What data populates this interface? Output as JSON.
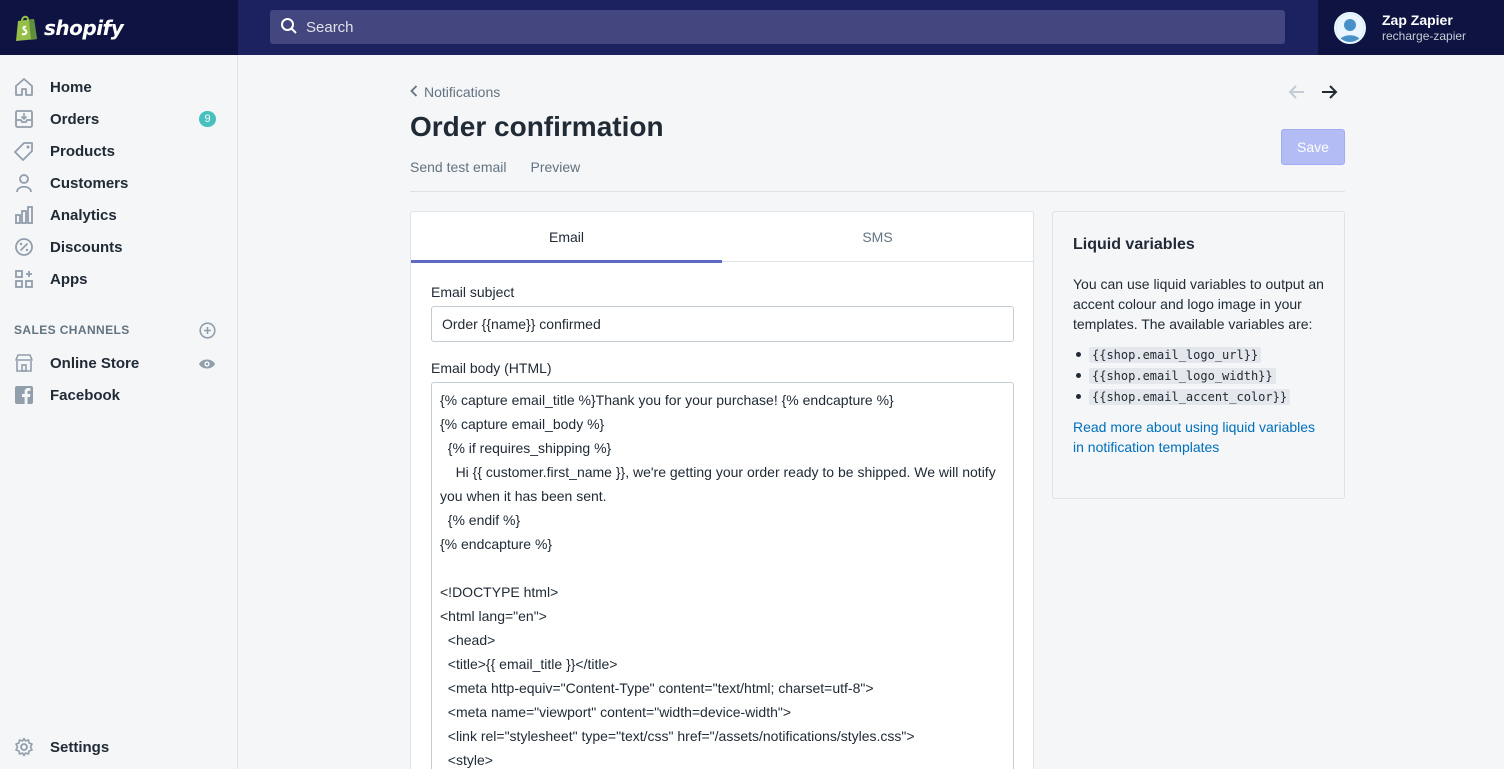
{
  "brand": {
    "name": "shopify"
  },
  "search": {
    "placeholder": "Search"
  },
  "user": {
    "name": "Zap Zapier",
    "store": "recharge-zapier"
  },
  "sidebar": {
    "items": [
      {
        "label": "Home",
        "icon": "home-icon"
      },
      {
        "label": "Orders",
        "icon": "orders-icon",
        "badge": "9"
      },
      {
        "label": "Products",
        "icon": "tag-icon"
      },
      {
        "label": "Customers",
        "icon": "person-icon"
      },
      {
        "label": "Analytics",
        "icon": "bar-chart-icon"
      },
      {
        "label": "Discounts",
        "icon": "discount-icon"
      },
      {
        "label": "Apps",
        "icon": "apps-icon"
      }
    ],
    "sales_channels_title": "SALES CHANNELS",
    "channels": [
      {
        "label": "Online Store",
        "icon": "store-icon"
      },
      {
        "label": "Facebook",
        "icon": "facebook-icon"
      }
    ],
    "settings_label": "Settings"
  },
  "page": {
    "breadcrumb": "Notifications",
    "title": "Order confirmation",
    "actions": [
      "Send test email",
      "Preview"
    ],
    "save_label": "Save"
  },
  "editor": {
    "tabs": [
      "Email",
      "SMS"
    ],
    "active_tab": "Email",
    "subject_label": "Email subject",
    "subject_value": "Order {{name}} confirmed",
    "body_label": "Email body (HTML)",
    "body_lines": [
      "{% capture email_title %}Thank you for your purchase! {% endcapture %}",
      "{% capture email_body %}",
      "  {% if requires_shipping %}",
      "    Hi {{ customer.first_name }}, we're getting your order ready to be shipped. We will notify you when it has been sent.",
      "  {% endif %}",
      "{% endcapture %}",
      "",
      "<!DOCTYPE html>",
      "<html lang=\"en\">",
      "  <head>",
      "  <title>{{ email_title }}</title>",
      "  <meta http-equiv=\"Content-Type\" content=\"text/html; charset=utf-8\">",
      "  <meta name=\"viewport\" content=\"width=device-width\">",
      "  <link rel=\"stylesheet\" type=\"text/css\" href=\"/assets/notifications/styles.css\">",
      "  <style>"
    ]
  },
  "liquid": {
    "title": "Liquid variables",
    "description": "You can use liquid variables to output an accent colour and logo image in your templates. The available variables are:",
    "variables": [
      "{{shop.email_logo_url}}",
      "{{shop.email_logo_width}}",
      "{{shop.email_accent_color}}"
    ],
    "link": "Read more about using liquid variables in notification templates"
  }
}
